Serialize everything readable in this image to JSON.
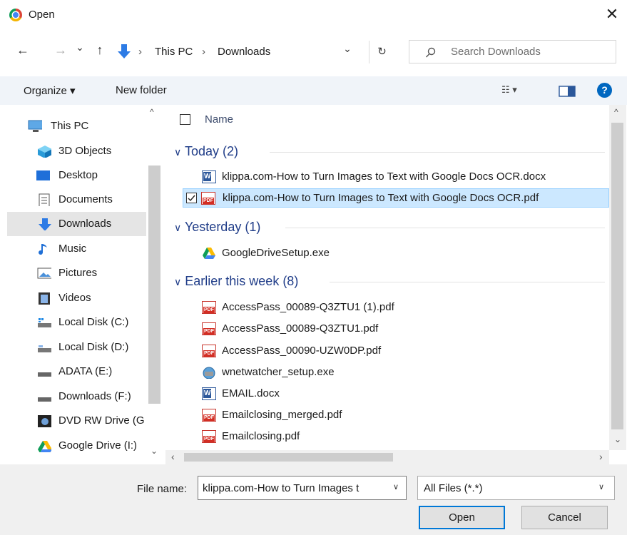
{
  "window": {
    "title": "Open",
    "close_glyph": "✕",
    "icon": "chrome-icon"
  },
  "nav": {
    "back": "←",
    "forward": "→",
    "recent": "⌄",
    "up": "↑",
    "breadcrumbs": [
      "This PC",
      "Downloads"
    ],
    "separator": "›",
    "dropdown": "⌄",
    "refresh": "↻",
    "search_placeholder": "Search Downloads"
  },
  "toolbar": {
    "organize": "Organize ▾",
    "new_folder": "New folder",
    "view_glyph": "☷ ▾",
    "help": "?"
  },
  "sidebar": {
    "items": [
      {
        "label": "This PC",
        "icon": "computer-icon"
      },
      {
        "label": "3D Objects",
        "icon": "cube-icon"
      },
      {
        "label": "Desktop",
        "icon": "desktop-icon"
      },
      {
        "label": "Documents",
        "icon": "document-icon"
      },
      {
        "label": "Downloads",
        "icon": "download-icon",
        "selected": true
      },
      {
        "label": "Music",
        "icon": "music-icon"
      },
      {
        "label": "Pictures",
        "icon": "pictures-icon"
      },
      {
        "label": "Videos",
        "icon": "video-icon"
      },
      {
        "label": "Local Disk (C:)",
        "icon": "drive-icon"
      },
      {
        "label": "Local Disk (D:)",
        "icon": "drive-icon"
      },
      {
        "label": "ADATA (E:)",
        "icon": "drive-icon"
      },
      {
        "label": "Downloads (F:)",
        "icon": "drive-icon"
      },
      {
        "label": "DVD RW Drive (G",
        "icon": "dvd-icon"
      },
      {
        "label": "Google Drive (I:)",
        "icon": "google-drive-icon"
      }
    ]
  },
  "filelist": {
    "column_name": "Name",
    "groups": [
      {
        "title": "Today (2)",
        "files": [
          {
            "name": "klippa.com-How to Turn Images to Text with Google Docs OCR.docx",
            "type": "docx"
          },
          {
            "name": "klippa.com-How to Turn Images to Text with Google Docs OCR.pdf",
            "type": "pdf",
            "selected": true
          }
        ]
      },
      {
        "title": "Yesterday (1)",
        "files": [
          {
            "name": "GoogleDriveSetup.exe",
            "type": "exe-gdrive"
          }
        ]
      },
      {
        "title": "Earlier this week (8)",
        "files": [
          {
            "name": "AccessPass_00089-Q3ZTU1 (1).pdf",
            "type": "pdf"
          },
          {
            "name": "AccessPass_00089-Q3ZTU1.pdf",
            "type": "pdf"
          },
          {
            "name": "AccessPass_00090-UZW0DP.pdf",
            "type": "pdf"
          },
          {
            "name": "wnetwatcher_setup.exe",
            "type": "exe"
          },
          {
            "name": "EMAIL.docx",
            "type": "docx"
          },
          {
            "name": "Emailclosing_merged.pdf",
            "type": "pdf"
          },
          {
            "name": "Emailclosing.pdf",
            "type": "pdf"
          }
        ]
      }
    ]
  },
  "footer": {
    "file_name_label": "File name:",
    "file_name_value": "klippa.com-How to Turn Images t",
    "filter_value": "All Files (*.*)",
    "open": "Open",
    "cancel": "Cancel"
  },
  "colors": {
    "accent": "#0078d7",
    "group_header": "#1f3c88",
    "selection": "#cce8ff",
    "pdf_red": "#d32e24",
    "word_blue": "#2b579a"
  }
}
